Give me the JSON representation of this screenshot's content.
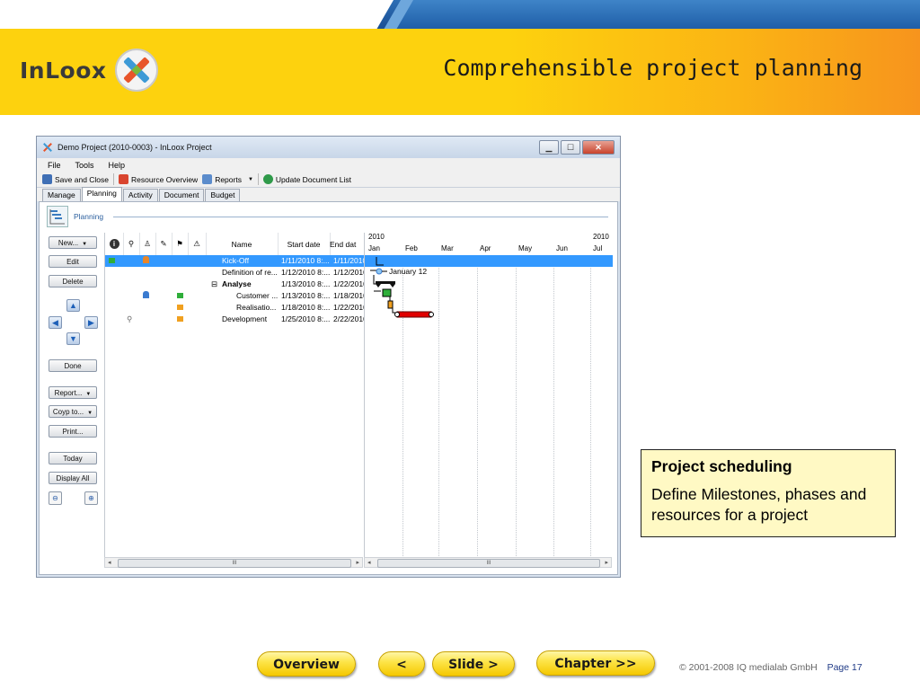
{
  "slide": {
    "logo_text": "InLoox",
    "title": "Comprehensible project planning"
  },
  "window": {
    "title": "Demo Project (2010-0003) - InLoox Project",
    "menu": [
      "File",
      "Tools",
      "Help"
    ],
    "toolbar": {
      "save_close": "Save and Close",
      "resource_overview": "Resource Overview",
      "reports": "Reports",
      "update_docs": "Update Document List"
    },
    "tabs": [
      "Manage",
      "Planning",
      "Activity",
      "Document",
      "Budget"
    ],
    "active_tab": "Planning",
    "section_label": "Planning",
    "left_buttons": {
      "new": "New...",
      "edit": "Edit",
      "delete": "Delete",
      "done": "Done",
      "report": "Report...",
      "copy": "Coyp to...",
      "print": "Print...",
      "today": "Today",
      "display_all": "Display All"
    },
    "grid": {
      "columns": {
        "name": "Name",
        "start": "Start date",
        "end": "End dat"
      },
      "rows": [
        {
          "name": "Kick-Off",
          "start": "1/11/2010 8:...",
          "end": "1/11/2010"
        },
        {
          "name": "Definition of re...",
          "start": "1/12/2010 8:...",
          "end": "1/12/2010"
        },
        {
          "name": "Analyse",
          "start": "1/13/2010 8:...",
          "end": "1/22/2010"
        },
        {
          "name": "Customer ...",
          "start": "1/13/2010 8:...",
          "end": "1/18/2010"
        },
        {
          "name": "Realisatio...",
          "start": "1/18/2010 8:...",
          "end": "1/22/2010"
        },
        {
          "name": "Development",
          "start": "1/25/2010 8:...",
          "end": "2/22/2010"
        }
      ]
    },
    "gantt": {
      "years": [
        "2010",
        "2010"
      ],
      "months": [
        "Jan",
        "Feb",
        "Mar",
        "Apr",
        "May",
        "Jun",
        "Jul"
      ],
      "milestone_label": "January 12"
    },
    "scrollbar_thumb": "III"
  },
  "callout": {
    "title": "Project scheduling",
    "body": "Define Milestones, phases and resources for a project"
  },
  "nav": {
    "overview": "Overview",
    "prev": "<",
    "next": "Slide >",
    "chapter": "Chapter >>"
  },
  "footer": {
    "copyright": "© 2001-2008 IQ medialab GmbH",
    "page": "Page 17"
  },
  "colors": {
    "header_yellow": "#fdd20e",
    "header_orange": "#f7941d",
    "selection_blue": "#3399ff",
    "callout_bg": "#fff9c4",
    "bar_red": "#e00000"
  }
}
